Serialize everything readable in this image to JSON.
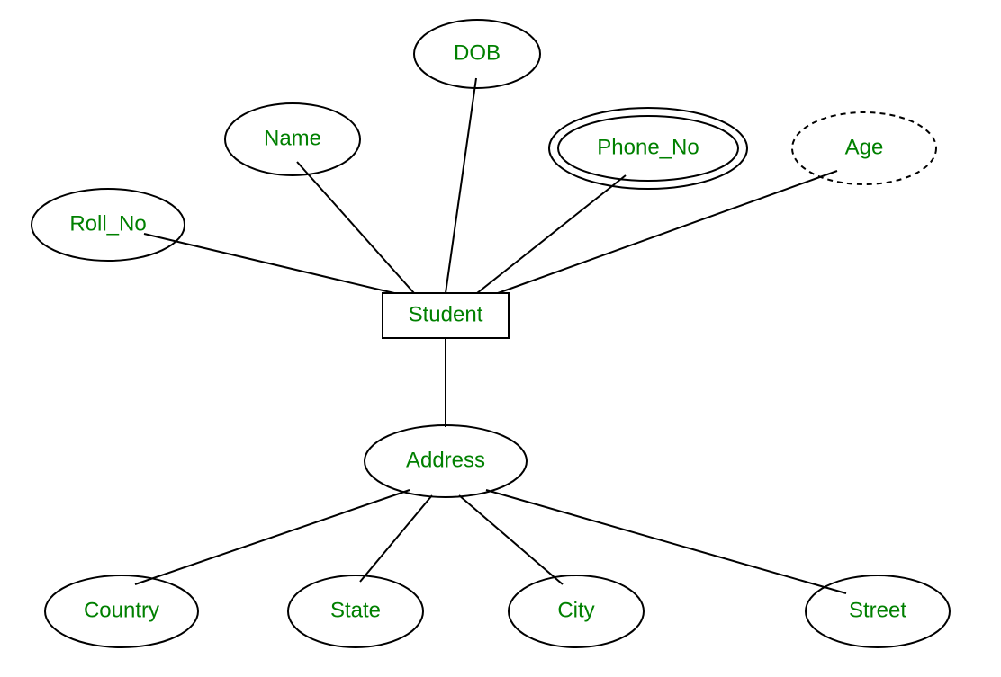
{
  "diagram": {
    "entity": {
      "student": "Student"
    },
    "attributes": {
      "roll_no": "Roll_No",
      "name": "Name",
      "dob": "DOB",
      "phone_no": "Phone_No",
      "age": "Age",
      "address": "Address"
    },
    "sub_attributes": {
      "country": "Country",
      "state": "State",
      "city": "City",
      "street": "Street"
    }
  }
}
